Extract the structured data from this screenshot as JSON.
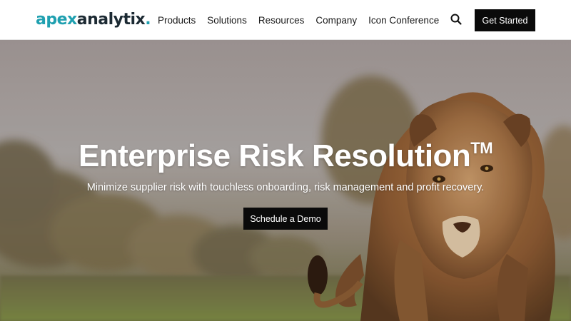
{
  "header": {
    "logo": {
      "part1": "apex",
      "part2": "analytix",
      "dot": "."
    },
    "nav": [
      {
        "label": "Products"
      },
      {
        "label": "Solutions"
      },
      {
        "label": "Resources"
      },
      {
        "label": "Company"
      },
      {
        "label": "Icon Conference"
      }
    ],
    "search_icon": "search-icon",
    "cta_label": "Get Started"
  },
  "hero": {
    "title": "Enterprise Risk Resolution",
    "trademark": "TM",
    "subtitle": "Minimize supplier risk with touchless onboarding, risk management and profit recovery.",
    "button_label": "Schedule a Demo"
  },
  "colors": {
    "brand_teal": "#1fa0b0",
    "brand_dark": "#1c2a33",
    "button_bg": "#0a0a0a"
  }
}
